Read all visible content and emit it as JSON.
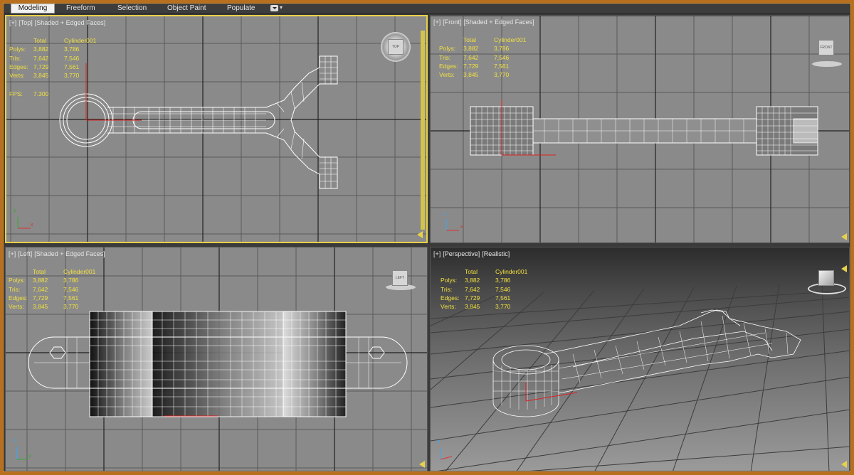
{
  "ribbon": {
    "tabs": [
      "Modeling",
      "Freeform",
      "Selection",
      "Object Paint",
      "Populate"
    ],
    "active_tab": "Modeling"
  },
  "stats_labels": {
    "total": "Total",
    "object": "Cylinder001",
    "polys": "Polys:",
    "tris": "Tris:",
    "edges": "Edges:",
    "verts": "Verts:",
    "fps": "FPS:"
  },
  "stats_values": {
    "polys_total": "3,882",
    "polys_obj": "3,786",
    "tris_total": "7,642",
    "tris_obj": "7,546",
    "edges_total": "7,729",
    "edges_obj": "7,561",
    "verts_total": "3,845",
    "verts_obj": "3,770",
    "fps": "7.300"
  },
  "viewports": {
    "top": {
      "plus": "[+]",
      "view": "[Top]",
      "shading": "[Shaded + Edged Faces]",
      "cube": "TOP"
    },
    "front": {
      "plus": "[+]",
      "view": "[Front]",
      "shading": "[Shaded + Edged Faces]",
      "cube": "FRONT"
    },
    "left": {
      "plus": "[+]",
      "view": "[Left]",
      "shading": "[Shaded + Edged Faces]",
      "cube": "LEFT"
    },
    "persp": {
      "plus": "[+]",
      "view": "[Perspective]",
      "shading": "[Realistic]"
    }
  },
  "axes": {
    "x": "x",
    "y": "y",
    "z": "z"
  },
  "colors": {
    "accent_frame": "#b86f1e",
    "active_viewport": "#e8d04a",
    "stats_text": "#f0e040",
    "viewport_bg": "#8a8a8a",
    "wire": "#ffffff",
    "grid": "#222222"
  }
}
